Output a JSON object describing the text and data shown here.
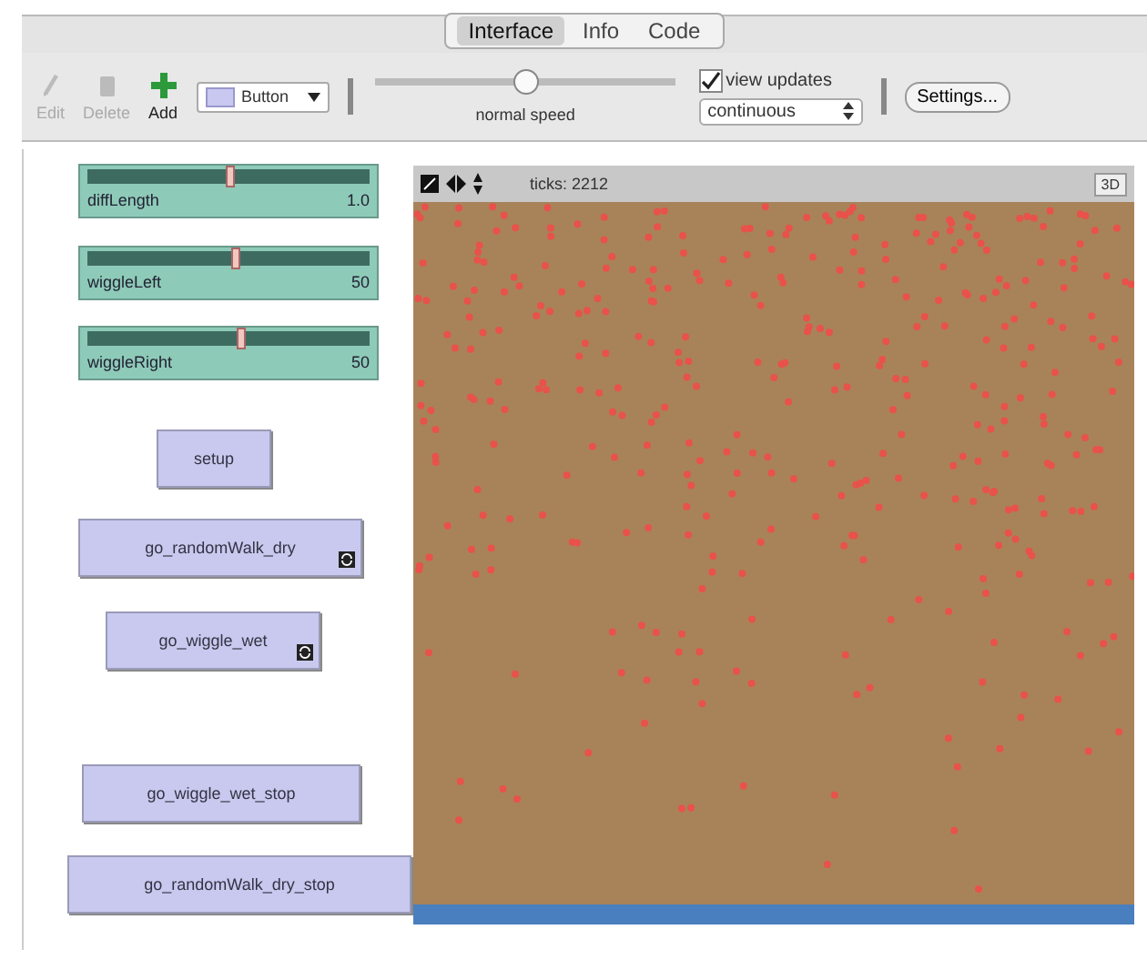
{
  "tabs": [
    {
      "label": "Interface",
      "selected": true
    },
    {
      "label": "Info",
      "selected": false
    },
    {
      "label": "Code",
      "selected": false
    }
  ],
  "toolbar": {
    "edit": {
      "label": "Edit",
      "disabled": true
    },
    "delete": {
      "label": "Delete",
      "disabled": true
    },
    "add": {
      "label": "Add",
      "disabled": false
    },
    "widget_type": "Button",
    "speed": {
      "level": 0.5,
      "label": "normal speed"
    },
    "view_updates": {
      "label": "view updates",
      "checked": true
    },
    "update_mode": "continuous",
    "settings": "Settings..."
  },
  "widgets": [
    {
      "kind": "slider",
      "name": "diffLength",
      "value": "1.0",
      "level": 0.5
    },
    {
      "kind": "slider",
      "name": "wiggleLeft",
      "value": "50",
      "level": 0.52
    },
    {
      "kind": "slider",
      "name": "wiggleRight",
      "value": "50",
      "level": 0.54
    },
    {
      "kind": "button",
      "name": "setup",
      "forever": false
    },
    {
      "kind": "button",
      "name": "go_randomWalk_dry",
      "forever": true
    },
    {
      "kind": "button",
      "name": "go_wiggle_wet",
      "forever": true
    },
    {
      "kind": "button",
      "name": "go_wiggle_wet_stop",
      "forever": false
    },
    {
      "kind": "button",
      "name": "go_randomWalk_dry_stop",
      "forever": false
    }
  ],
  "view": {
    "ticks": "ticks: 2212",
    "three_d": "3D"
  }
}
